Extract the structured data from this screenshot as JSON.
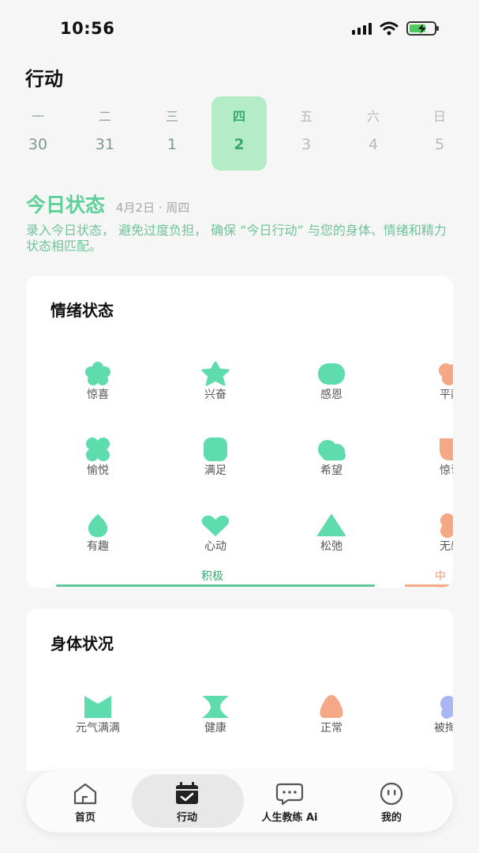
{
  "status_bar": {
    "time": "10:56"
  },
  "page": {
    "title": "行动"
  },
  "week": [
    {
      "weekday": "一",
      "date": "30",
      "state": "past"
    },
    {
      "weekday": "二",
      "date": "31",
      "state": "past"
    },
    {
      "weekday": "三",
      "date": "1",
      "state": "past"
    },
    {
      "weekday": "四",
      "date": "2",
      "state": "active"
    },
    {
      "weekday": "五",
      "date": "3",
      "state": "future"
    },
    {
      "weekday": "六",
      "date": "4",
      "state": "future"
    },
    {
      "weekday": "日",
      "date": "5",
      "state": "future"
    }
  ],
  "today_status": {
    "title": "今日状态",
    "date": "4月2日 · 周四",
    "description": "录入今日状态， 避免过度负担， 确保 “今日行动” 与您的身体、情绪和精力状态相匹配。"
  },
  "emotion_card": {
    "title": "情绪状态",
    "items": [
      {
        "label": "惊喜",
        "icon": "flower-shape",
        "color": "#5fdcae"
      },
      {
        "label": "兴奋",
        "icon": "star-shape",
        "color": "#5fdcae"
      },
      {
        "label": "感恩",
        "icon": "rounded-blob-shape",
        "color": "#5fdcae"
      },
      {
        "label": "平静",
        "icon": "cloud-shape",
        "color": "#f4a886"
      },
      {
        "label": "愉悦",
        "icon": "clover-shape",
        "color": "#5fdcae"
      },
      {
        "label": "满足",
        "icon": "rounded-square-shape",
        "color": "#5fdcae"
      },
      {
        "label": "希望",
        "icon": "cloud-shape",
        "color": "#5fdcae"
      },
      {
        "label": "惊讶",
        "icon": "shield-shape",
        "color": "#f4a886"
      },
      {
        "label": "有趣",
        "icon": "drop-shape",
        "color": "#5fdcae"
      },
      {
        "label": "心动",
        "icon": "heart-shape",
        "color": "#5fdcae"
      },
      {
        "label": "松弛",
        "icon": "triangle-shape",
        "color": "#5fdcae"
      },
      {
        "label": "无感",
        "icon": "blob-shape",
        "color": "#f4a886"
      }
    ],
    "categories": [
      {
        "label": "积极",
        "color": "#3ca871"
      },
      {
        "label": "中性",
        "color": "#f09a76"
      }
    ]
  },
  "body_card": {
    "title": "身体状况",
    "items": [
      {
        "label": "元气满满",
        "icon": "bookmark-shape",
        "color": "#5fdcae"
      },
      {
        "label": "健康",
        "icon": "hourglass-shape",
        "color": "#5fdcae"
      },
      {
        "label": "正常",
        "icon": "round-triangle-shape",
        "color": "#f4a886"
      },
      {
        "label": "被掏空",
        "icon": "blob-shape",
        "color": "#a9b6f4"
      }
    ]
  },
  "tab_bar": {
    "tabs": [
      {
        "label": "首页",
        "icon": "home-icon"
      },
      {
        "label": "行动",
        "icon": "calendar-check-icon",
        "active": true
      },
      {
        "label": "人生教练 Ai",
        "icon": "chat-bubble-icon"
      },
      {
        "label": "我的",
        "icon": "face-icon"
      }
    ]
  }
}
